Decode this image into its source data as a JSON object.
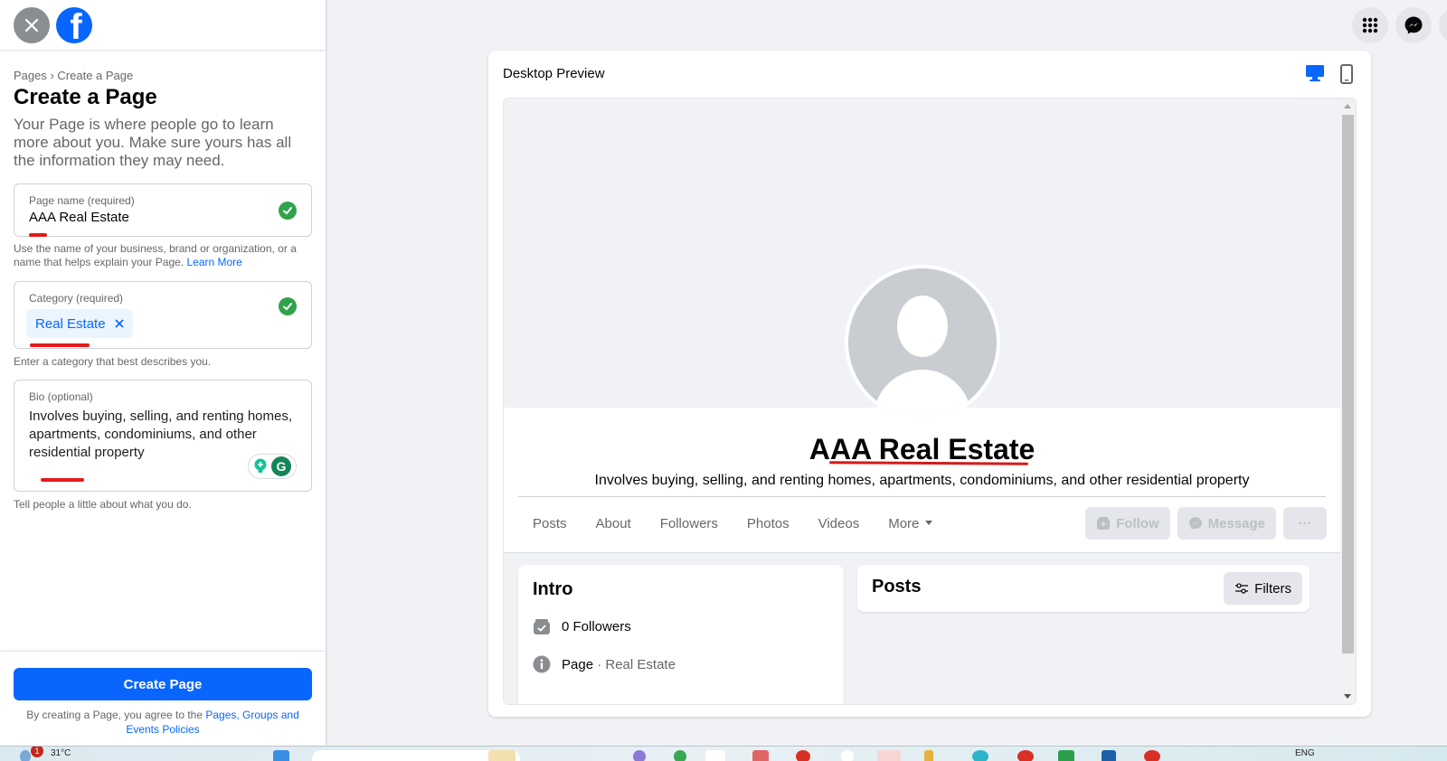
{
  "left_panel": {
    "breadcrumb": "Pages › Create a Page",
    "title": "Create a Page",
    "intro": "Your Page is where people go to learn more about you. Make sure yours has all the information they may need.",
    "page_name": {
      "label": "Page name (required)",
      "value": "AAA Real Estate",
      "helper": "Use the name of your business, brand or organization, or a name that helps explain your Page.",
      "helper_link": "Learn More"
    },
    "category": {
      "label": "Category (required)",
      "chip": "Real Estate",
      "helper": "Enter a category that best describes you."
    },
    "bio": {
      "label": "Bio (optional)",
      "value": "Involves buying, selling, and renting homes, apartments, condominiums, and other residential property",
      "helper": "Tell people a little about what you do."
    },
    "create_button": "Create Page",
    "terms_prefix": "By creating a Page, you agree to the",
    "terms_link": "Pages, Groups and Events Policies"
  },
  "preview": {
    "title": "Desktop Preview",
    "page_name": "AAA Real Estate",
    "page_bio": "Involves buying, selling, and renting homes, apartments, condominiums, and other residential property",
    "tabs": [
      "Posts",
      "About",
      "Followers",
      "Photos",
      "Videos",
      "More"
    ],
    "actions": {
      "follow": "Follow",
      "message": "Message",
      "more": "···"
    },
    "intro": {
      "title": "Intro",
      "followers": "0 Followers",
      "page_prefix": "Page",
      "page_category": "· Real Estate"
    },
    "posts": {
      "title": "Posts",
      "filters": "Filters"
    }
  },
  "taskbar": {
    "weather": "31°C",
    "weather_badge": "1",
    "lang": "ENG"
  },
  "colors": {
    "accent": "#0866ff",
    "success": "#31a24c",
    "annotation": "#e41b1b"
  }
}
